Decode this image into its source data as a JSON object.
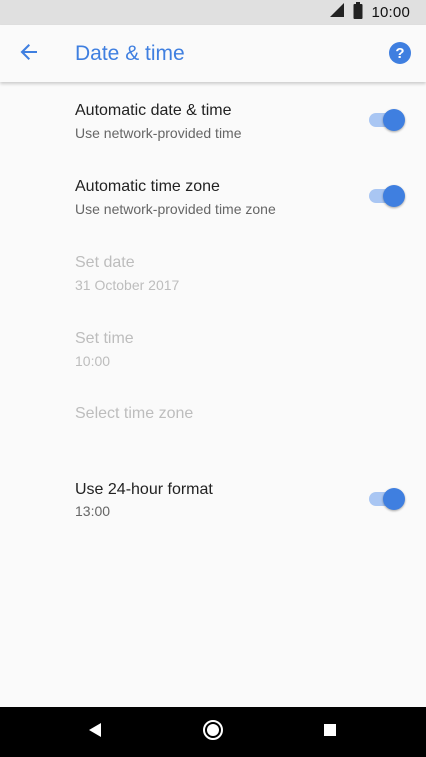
{
  "status_bar": {
    "time": "10:00"
  },
  "app_bar": {
    "title": "Date & time"
  },
  "settings": [
    {
      "title": "Automatic date & time",
      "summary": "Use network-provided time",
      "enabled": true,
      "toggle": true,
      "checked": true
    },
    {
      "title": "Automatic time zone",
      "summary": "Use network-provided time zone",
      "enabled": true,
      "toggle": true,
      "checked": true
    },
    {
      "title": "Set date",
      "summary": "31 October 2017",
      "enabled": false,
      "toggle": false
    },
    {
      "title": "Set time",
      "summary": "10:00",
      "enabled": false,
      "toggle": false
    },
    {
      "title": "Select time zone",
      "summary": "",
      "enabled": false,
      "toggle": false
    },
    {
      "title": "Use 24-hour format",
      "summary": "13:00",
      "enabled": true,
      "toggle": true,
      "checked": true
    }
  ],
  "colors": {
    "accent": "#3f7fe0",
    "toggle_track": "#a9c6f3",
    "status_bar": "#e0e0e0",
    "nav_bar": "#000000",
    "disabled_text": "#bdbdbd"
  },
  "icons": {
    "status": [
      "signal-icon",
      "battery-icon"
    ],
    "app_bar": [
      "back-arrow-icon",
      "help-icon"
    ],
    "nav": [
      "back-triangle-icon",
      "home-circle-icon",
      "recents-square-icon"
    ]
  }
}
